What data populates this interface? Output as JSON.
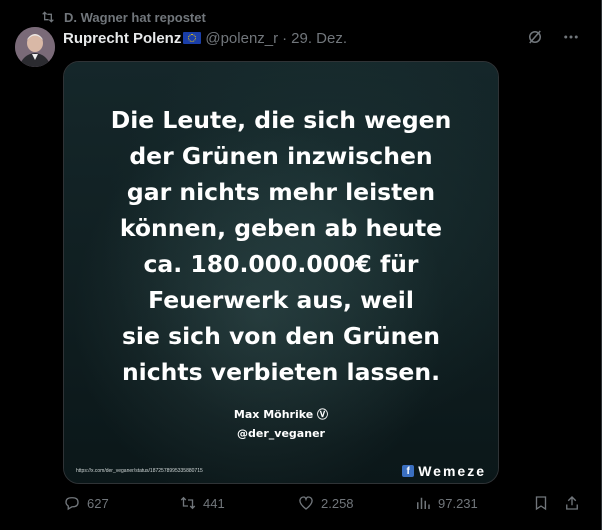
{
  "repost": {
    "text": "D. Wagner hat repostet",
    "icon": "repost-icon"
  },
  "author": {
    "name": "Ruprecht Polenz",
    "flag": "eu-flag",
    "handle": "@polenz_r",
    "separator": "·",
    "date": "29. Dez."
  },
  "top_icons": [
    "grok-icon",
    "more-icon"
  ],
  "image": {
    "lines": [
      "Die Leute, die sich wegen",
      "der Grünen inzwischen",
      "gar nichts mehr leisten",
      "können, geben ab heute",
      "ca. 180.000.000€ für",
      "Feuerwerk aus, weil",
      "sie sich von den Grünen",
      "nichts verbieten lassen."
    ],
    "attribution_name": "Max Möhrike Ⓥ",
    "attribution_handle": "@der_veganer",
    "source_url": "https://x.com/der_veganer/status/1872578995335880715",
    "brand": "Wemeze",
    "brand_icon": "f"
  },
  "actions": {
    "replies": "627",
    "reposts": "441",
    "likes": "2.258",
    "views": "97.231"
  },
  "colors": {
    "background": "#000000",
    "muted": "#71767b",
    "text": "#e7e9ea"
  }
}
